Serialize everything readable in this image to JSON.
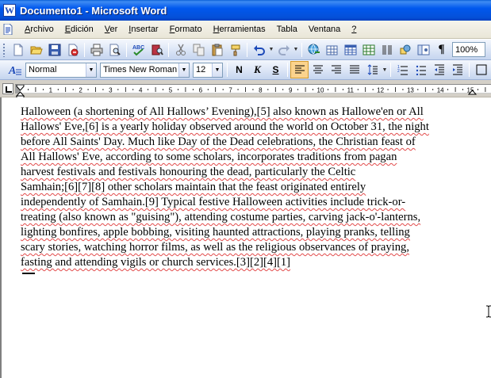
{
  "window": {
    "title": "Documento1 - Microsoft Word",
    "app_icon_letter": "W"
  },
  "menu": {
    "items": [
      {
        "label": "Archivo",
        "accel": "A",
        "rest": "rchivo"
      },
      {
        "label": "Edición",
        "accel": "E",
        "rest": "dición"
      },
      {
        "label": "Ver",
        "accel": "V",
        "rest": "er"
      },
      {
        "label": "Insertar",
        "accel": "I",
        "rest": "nsertar"
      },
      {
        "label": "Formato",
        "accel": "F",
        "rest": "ormato"
      },
      {
        "label": "Herramientas",
        "accel": "H",
        "rest": "erramientas"
      },
      {
        "label": "Tabla",
        "accel": "",
        "rest": "Tabla"
      },
      {
        "label": "Ventana",
        "accel": "",
        "rest": "Ventana"
      },
      {
        "label": "?",
        "accel": "?",
        "rest": ""
      }
    ]
  },
  "standard_toolbar": {
    "zoom": "100%",
    "show_marks_glyph": "¶"
  },
  "format_toolbar": {
    "style": "Normal",
    "font": "Times New Roman",
    "size": "12",
    "bold_label": "N",
    "italic_label": "K",
    "underline_label": "S",
    "alignment": "left"
  },
  "ruler": {
    "tick_labels": [
      "1",
      "2",
      "3",
      "4",
      "5",
      "6",
      "7",
      "8",
      "9",
      "10",
      "11",
      "12",
      "13",
      "14",
      "15"
    ]
  },
  "document": {
    "lines": [
      "Halloween (a shortening of All Hallows’ Evening),[5] also known as Hallowe'en or All",
      "Hallows' Eve,[6] is a yearly holiday observed around the world on October 31, the night",
      "before All Saints' Day. Much like Day of the Dead celebrations, the Christian feast of",
      "All Hallows' Eve, according to some scholars, incorporates traditions from pagan",
      "harvest festivals and festivals honouring the dead, particularly the Celtic",
      "Samhain;[6][7][8] other scholars maintain that the feast originated entirely",
      "independently of Samhain.[9] Typical festive Halloween activities include trick-or-",
      "treating (also known as \"guising\"), attending costume parties, carving jack-o'-lanterns,",
      "lighting bonfires, apple bobbing, visiting haunted attractions, playing pranks, telling",
      "scary stories, watching horror films, as well as the religious observances of praying,",
      "fasting and attending vigils or church services.[3][2][4][1]"
    ]
  },
  "colors": {
    "titlebar": "#0058ee",
    "spellcheck_underline": "#e24b4b",
    "active_button": "#fbd38d"
  }
}
